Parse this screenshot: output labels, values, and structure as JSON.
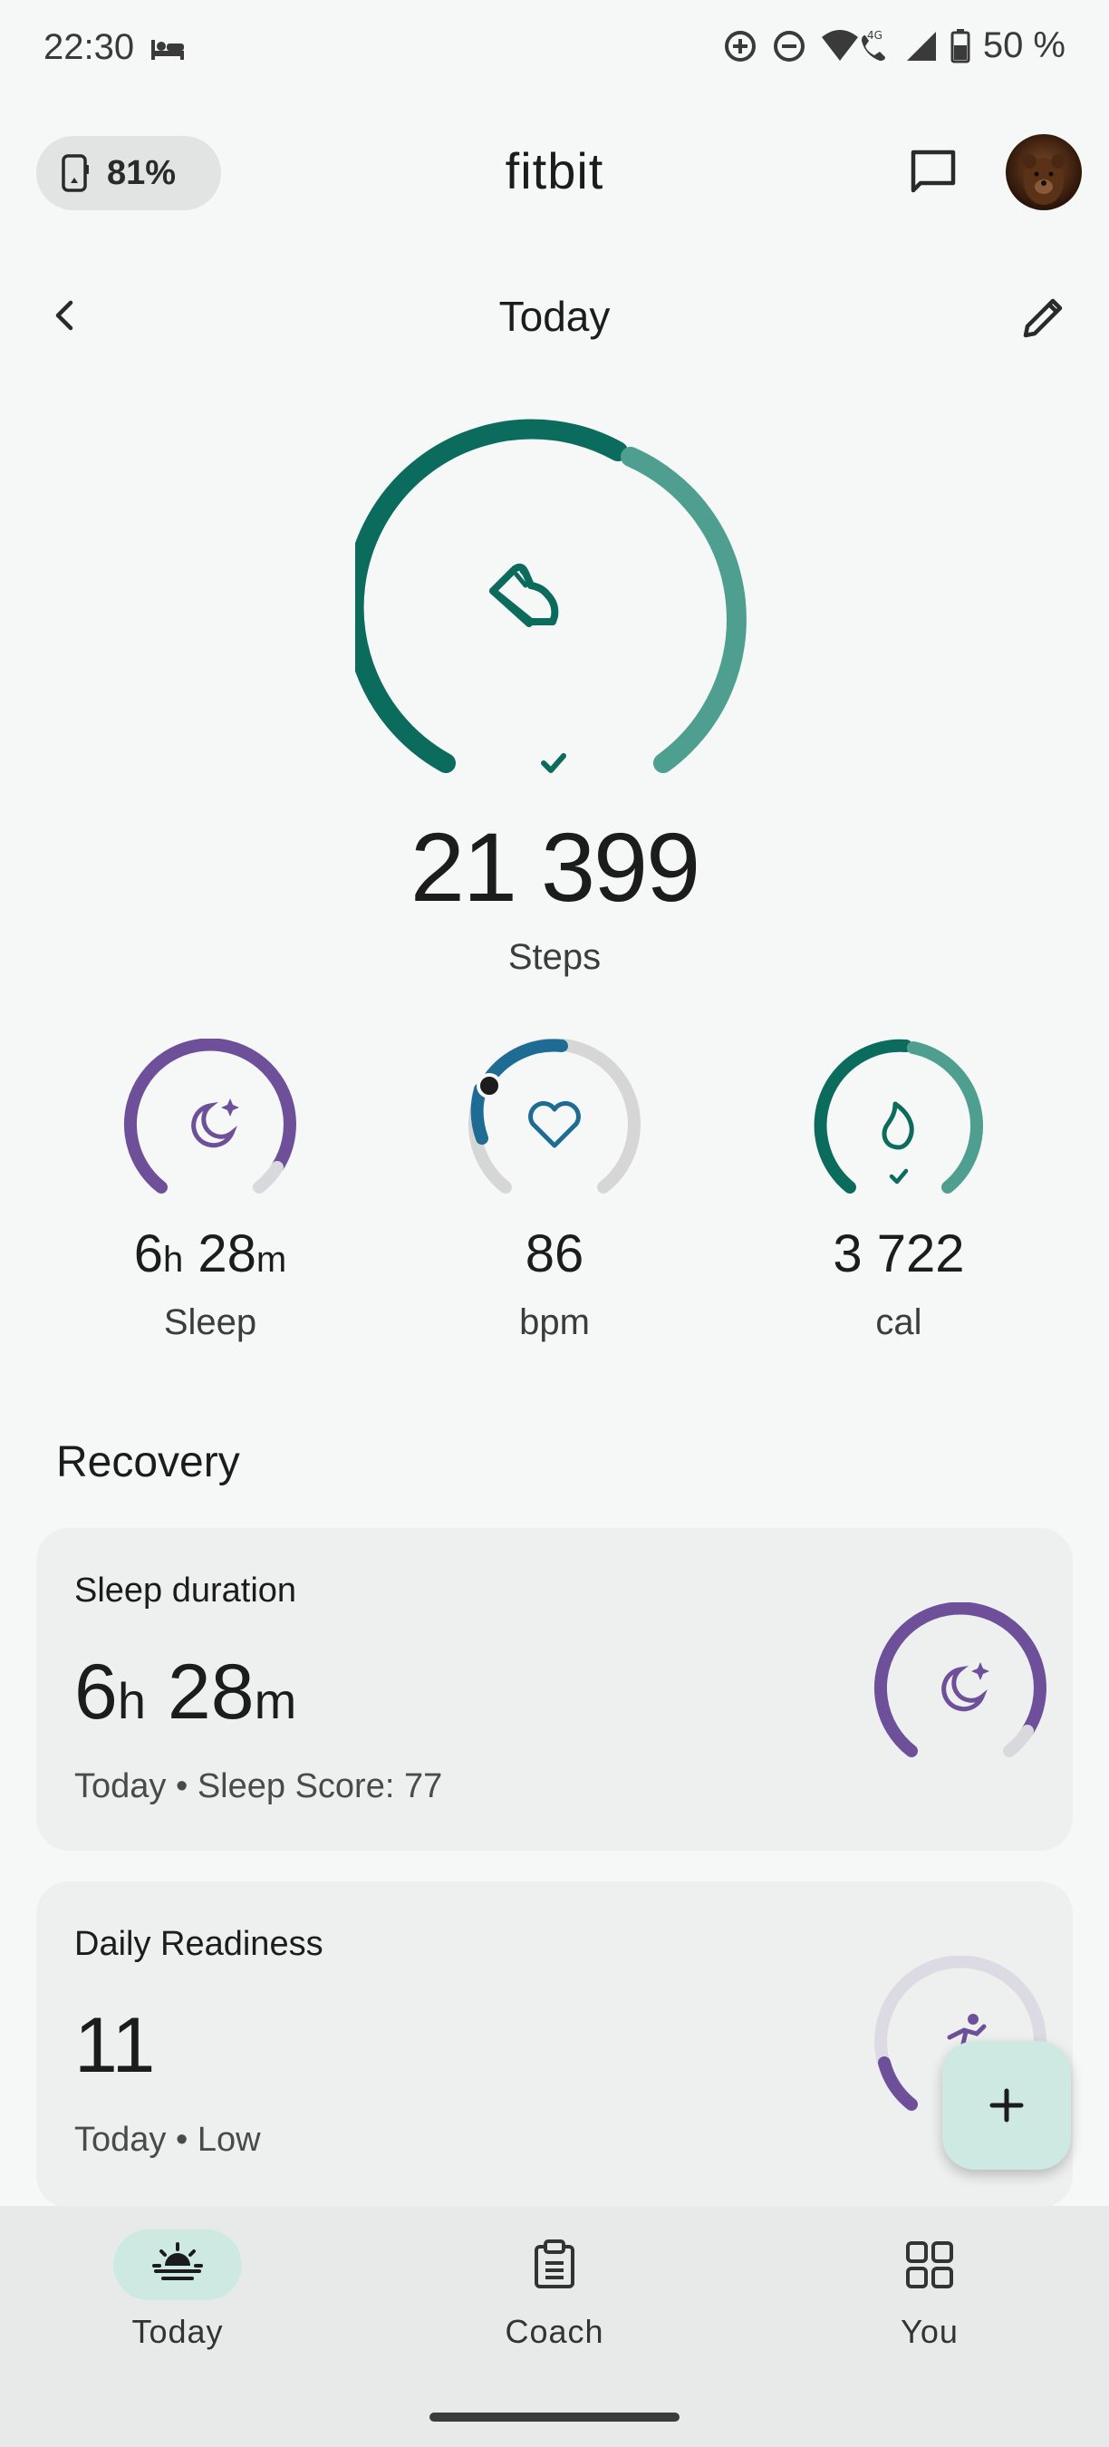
{
  "status_bar": {
    "time": "22:30",
    "network": "4G",
    "battery": "50 %",
    "icons": [
      "bed-icon",
      "data-saver-icon",
      "do-not-disturb-icon",
      "wifi-call-icon",
      "signal-icon",
      "battery-icon"
    ]
  },
  "header": {
    "device_battery": "81%",
    "app_title": "fitbit",
    "icons": [
      "watch-icon",
      "message-icon",
      "avatar"
    ]
  },
  "date_nav": {
    "title": "Today",
    "icons": [
      "back-chevron-icon",
      "edit-pencil-icon"
    ]
  },
  "steps": {
    "value": "21 399",
    "label": "Steps",
    "goal_progress": 1.0,
    "icon": "shoe-icon",
    "colors": {
      "complete": "#0b6b5c",
      "over": "#4f9f90"
    }
  },
  "stats": [
    {
      "value_h": "6",
      "unit_h": "h",
      "value_m": "28",
      "unit_m": "m",
      "label": "Sleep",
      "icon": "moon-stars-icon",
      "color": "#6e4f9a",
      "progress": 0.85
    },
    {
      "value": "86",
      "label": "bpm",
      "icon": "heart-icon",
      "color": "#1e6b93",
      "progress": 0.2
    },
    {
      "value": "3 722",
      "label": "cal",
      "icon": "flame-icon",
      "color": "#0b6b5c",
      "progress": 1.0
    }
  ],
  "recovery": {
    "title": "Recovery",
    "cards": [
      {
        "title": "Sleep duration",
        "value_h": "6",
        "unit_h": "h",
        "value_m": "28",
        "unit_m": "m",
        "sub": "Today • Sleep Score: 77",
        "icon": "moon-stars-icon",
        "progress": 0.85
      },
      {
        "title": "Daily Readiness",
        "value": "11",
        "sub": "Today • Low",
        "icon": "readiness-figure-icon",
        "progress": 0.11
      }
    ]
  },
  "fab": {
    "icon": "plus-icon"
  },
  "bottom_nav": [
    {
      "label": "Today",
      "icon": "sunrise-icon",
      "active": true
    },
    {
      "label": "Coach",
      "icon": "clipboard-icon",
      "active": false
    },
    {
      "label": "You",
      "icon": "grid-icon",
      "active": false
    }
  ]
}
